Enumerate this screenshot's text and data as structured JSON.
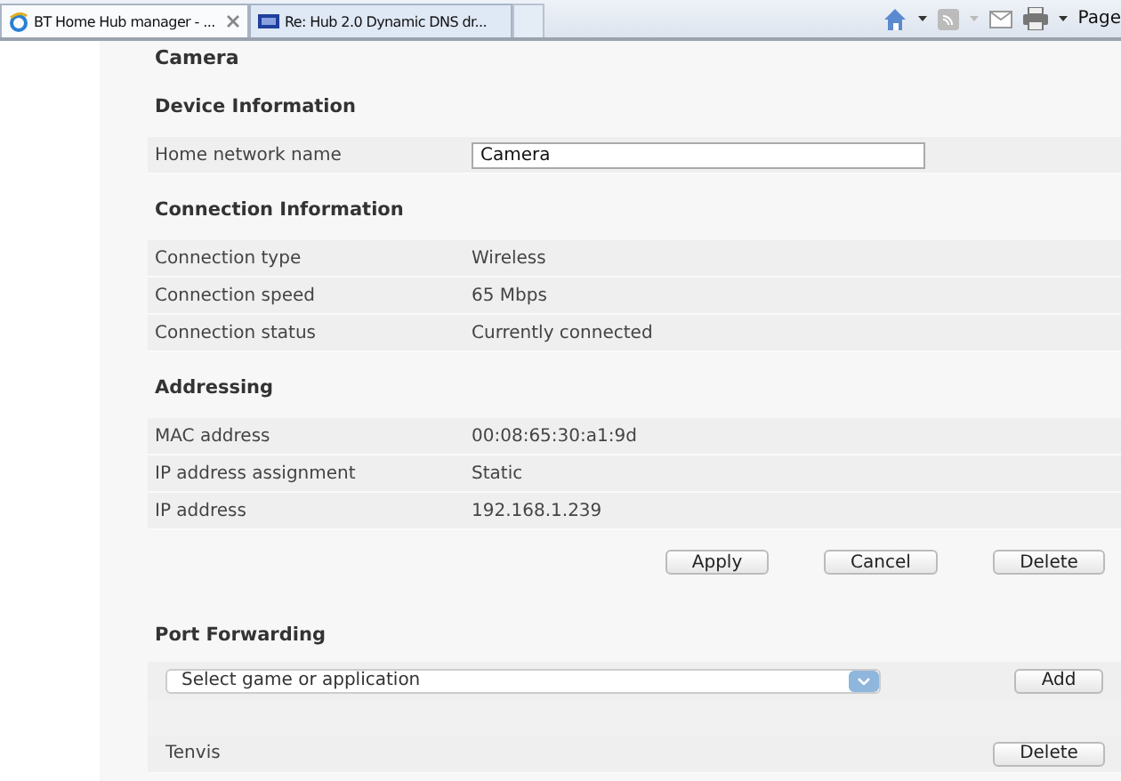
{
  "browser": {
    "tabs": [
      {
        "title": "BT Home Hub manager - ...",
        "selected": true,
        "kind": "ie"
      },
      {
        "title": "Re: Hub 2.0 Dynamic DNS dr...",
        "selected": false,
        "kind": "bt"
      }
    ],
    "toolbar": {
      "page_menu": "Page"
    }
  },
  "page": {
    "title": "Camera",
    "sections": [
      {
        "heading": "Device Information",
        "rows": [
          {
            "kind": "input",
            "label": "Home network name",
            "value": "Camera"
          }
        ]
      },
      {
        "heading": "Connection Information",
        "rows": [
          {
            "kind": "text",
            "label": "Connection type",
            "value": "Wireless"
          },
          {
            "kind": "text",
            "label": "Connection speed",
            "value": "65 Mbps"
          },
          {
            "kind": "text",
            "label": "Connection status",
            "value": "Currently connected"
          }
        ]
      },
      {
        "heading": "Addressing",
        "rows": [
          {
            "kind": "text",
            "label": "MAC address",
            "value": "00:08:65:30:a1:9d"
          },
          {
            "kind": "text",
            "label": "IP address assignment",
            "value": "Static"
          },
          {
            "kind": "text",
            "label": "IP address",
            "value": "192.168.1.239"
          }
        ]
      }
    ],
    "buttons": [
      "Apply",
      "Cancel",
      "Delete"
    ],
    "port_forwarding": {
      "heading": "Port Forwarding",
      "select": {
        "placeholder": "Select game or application"
      },
      "add_button": "Add",
      "rules": [
        {
          "name": "Tenvis",
          "button": "Delete"
        }
      ]
    }
  }
}
